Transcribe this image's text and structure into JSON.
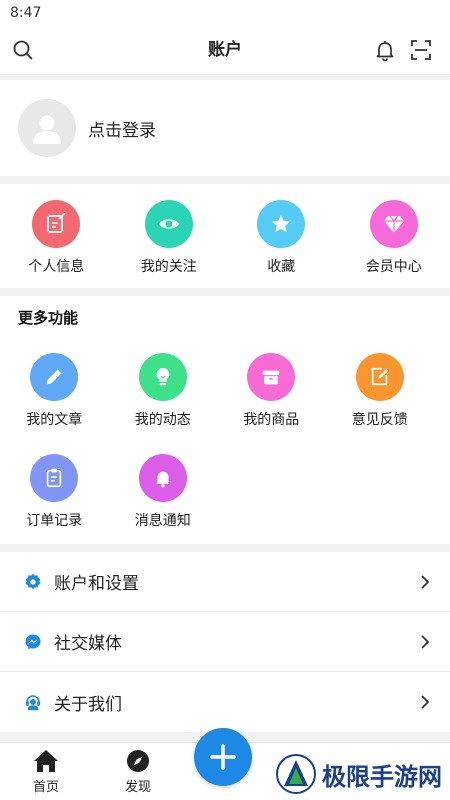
{
  "status_bar": {
    "time": "8:47"
  },
  "header": {
    "title": "账户"
  },
  "login": {
    "label": "点击登录"
  },
  "quick_actions": [
    {
      "label": "个人信息",
      "icon": "edit-icon",
      "color": "#f2696f"
    },
    {
      "label": "我的关注",
      "icon": "eye-icon",
      "color": "#2bd4b4"
    },
    {
      "label": "收藏",
      "icon": "star-icon",
      "color": "#55ccf5"
    },
    {
      "label": "会员中心",
      "icon": "diamond-icon",
      "color": "#f56ad8"
    }
  ],
  "more": {
    "title": "更多功能",
    "items": [
      {
        "label": "我的文章",
        "icon": "pencil-icon",
        "color": "#5ea8f5"
      },
      {
        "label": "我的动态",
        "icon": "bulb-icon",
        "color": "#3ee08a"
      },
      {
        "label": "我的商品",
        "icon": "box-icon",
        "color": "#f86ad4"
      },
      {
        "label": "意见反馈",
        "icon": "feedback-icon",
        "color": "#fb9530"
      },
      {
        "label": "订单记录",
        "icon": "clipboard-icon",
        "color": "#7f96f5"
      },
      {
        "label": "消息通知",
        "icon": "bell-icon",
        "color": "#db5ee8"
      }
    ]
  },
  "menu": [
    {
      "label": "账户和设置",
      "icon": "gear-icon"
    },
    {
      "label": "社交媒体",
      "icon": "messenger-icon"
    },
    {
      "label": "关于我们",
      "icon": "support-icon"
    }
  ],
  "tabbar": {
    "home": "首页",
    "discover": "发现"
  },
  "watermark": {
    "text": "极限手游网"
  },
  "colors": {
    "accent": "#1e88e5",
    "page_bg": "#f2f2f4"
  }
}
